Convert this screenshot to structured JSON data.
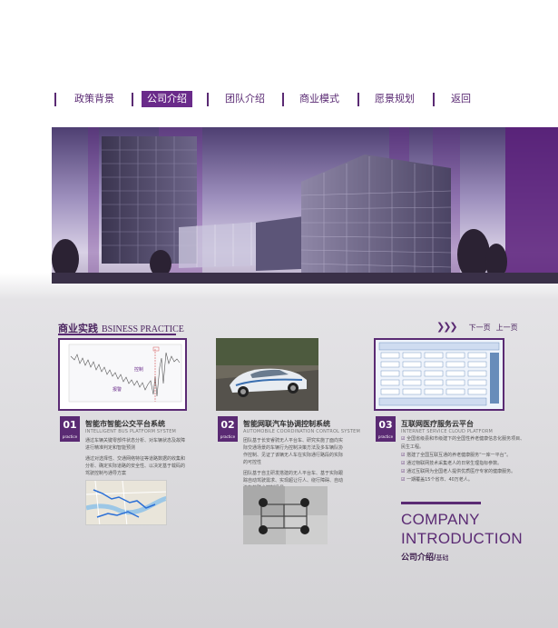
{
  "nav": {
    "items": [
      {
        "label": "政策背景",
        "active": false
      },
      {
        "label": "公司介绍",
        "active": true
      },
      {
        "label": "团队介绍",
        "active": false
      },
      {
        "label": "商业模式",
        "active": false
      },
      {
        "label": "愿景规划",
        "active": false
      },
      {
        "label": "返回",
        "active": false
      }
    ]
  },
  "section": {
    "title_cn": "商业实践",
    "title_en": "BSINESS PRACTICE",
    "prev_label": "下一页",
    "next_label": "上一页"
  },
  "cards": [
    {
      "number": "01",
      "number_tag": "practice",
      "title": "智能市智能公交平台系统",
      "subtitle": "INTELLIGENT BUS PLATFORM SYSTEM",
      "paragraphs": [
        "通过车辆关键零部件状态分析、对车辆状态及故障进行精准判定和智能预测",
        "通过对选择性、交通网络特征等道路数据的收集和分析、确定实际道路的安全性、以决定基于载码的驾驶控制与通导方案"
      ],
      "chart_labels": {
        "control": "控制",
        "alarm": "报警"
      }
    },
    {
      "number": "02",
      "number_tag": "practice",
      "title": "智能网联汽车协调控制系统",
      "subtitle": "AUTOMOBILE COORDINATION CONTROL SYSTEM",
      "paragraphs": [
        "团队基于长安睿骋无人平台车、研究实施了面向实际交通场景的车辆行为控制决策方法及多车辆队协作控制、见证了该辆无人车在实际通行路段的实际的可控性",
        "团队基于自主研发搭建的无人平台车、基于实际跟踪自动驾驶需求、实现超让行人、绕行障碍、自动泊车的联合控制场景"
      ]
    },
    {
      "number": "03",
      "number_tag": "practice",
      "title": "互联网医疗服务云平台",
      "subtitle": "INTERNET SERVICE CLOUD PLATFORM",
      "paragraphs": [
        "全国省级县和市级建下的全国性养老健康信息化服务项目、民生工程。"
      ],
      "bullets": [
        "搭建了全国互联互通的养老健康服务“一库一平台”。",
        "通过物联网技术采集老人的日常生理指标参数。",
        "通过互联网为全国老人提供优质医疗专家的健康服务。",
        "一期覆盖15个省市、40万老人。"
      ]
    }
  ],
  "company": {
    "line1": "COMPANY",
    "line2": "INTRODUCTION",
    "cn": "公司介绍/",
    "cn_small": "基础"
  },
  "colors": {
    "accent": "#5a2a73",
    "active_bg": "#6a2b8a"
  }
}
